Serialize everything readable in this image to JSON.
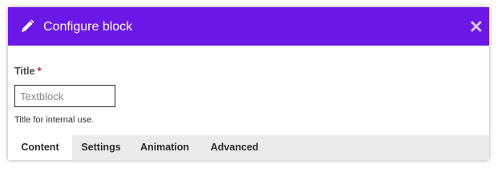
{
  "dialog": {
    "title": "Configure block",
    "icons": {
      "edit": "pencil-icon",
      "close": "close-icon"
    },
    "accent_color": "#6b17e6"
  },
  "form": {
    "title_label": "Title",
    "required_marker": "*",
    "title_placeholder": "Textblock",
    "title_value": "",
    "help_text": "Title for internal use."
  },
  "tabs": [
    {
      "label": "Content",
      "active": true
    },
    {
      "label": "Settings",
      "active": false
    },
    {
      "label": "Animation",
      "active": false
    },
    {
      "label": "Advanced",
      "active": false
    }
  ]
}
